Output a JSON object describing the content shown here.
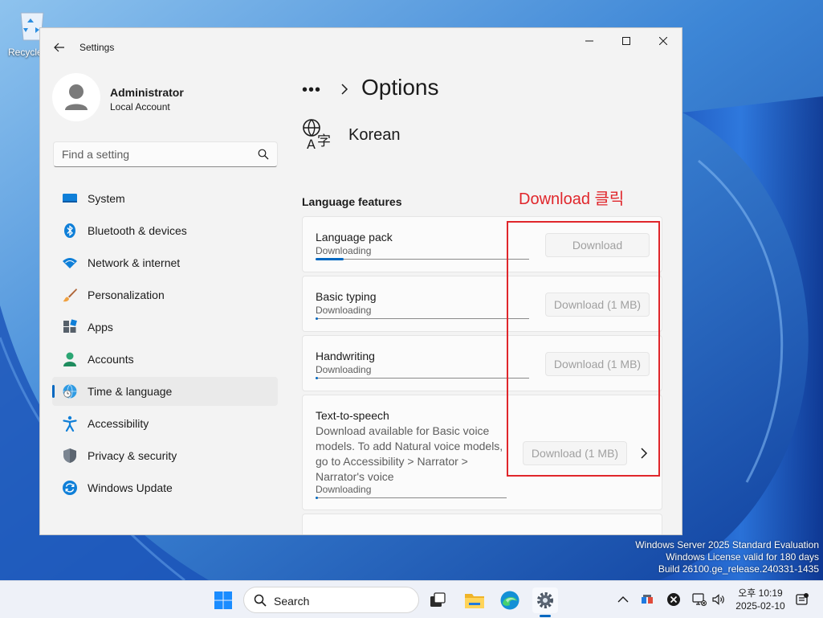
{
  "desktop": {
    "recycle_bin_label": "Recycle",
    "watermark": {
      "line1": "Windows Server 2025 Standard Evaluation",
      "line2": "Windows License valid for 180 days",
      "line3": "Build 26100.ge_release.240331-1435"
    }
  },
  "window": {
    "title": "Settings",
    "profile": {
      "name": "Administrator",
      "account_type": "Local Account"
    },
    "search": {
      "placeholder": "Find a setting"
    },
    "nav": [
      {
        "label": "System",
        "icon": "monitor-icon"
      },
      {
        "label": "Bluetooth & devices",
        "icon": "bluetooth-icon"
      },
      {
        "label": "Network & internet",
        "icon": "wifi-icon"
      },
      {
        "label": "Personalization",
        "icon": "brush-icon"
      },
      {
        "label": "Apps",
        "icon": "apps-icon"
      },
      {
        "label": "Accounts",
        "icon": "person-icon"
      },
      {
        "label": "Time & language",
        "icon": "globe-clock-icon",
        "active": true
      },
      {
        "label": "Accessibility",
        "icon": "accessibility-icon"
      },
      {
        "label": "Privacy & security",
        "icon": "shield-icon"
      },
      {
        "label": "Windows Update",
        "icon": "update-icon"
      }
    ],
    "breadcrumb": {
      "more": "•••",
      "page_title": "Options"
    },
    "language": {
      "name": "Korean",
      "icon": "language-icon"
    },
    "section_label": "Language features",
    "features": [
      {
        "title": "Language pack",
        "status": "Downloading",
        "button": "Download",
        "progress": 0.13
      },
      {
        "title": "Basic typing",
        "status": "Downloading",
        "button": "Download (1 MB)",
        "progress": 0.01
      },
      {
        "title": "Handwriting",
        "status": "Downloading",
        "button": "Download (1 MB)",
        "progress": 0.01
      },
      {
        "title": "Text-to-speech",
        "description": "Download available for Basic voice models. To add Natural voice models, go to Accessibility > Narrator > Narrator's voice",
        "status": "Downloading",
        "button": "Download (1 MB)",
        "progress": 0.01
      }
    ],
    "annotation": {
      "text": "Download 클릭",
      "color": "#e0262b"
    }
  },
  "taskbar": {
    "search_label": "Search",
    "clock": {
      "time": "오후 10:19",
      "date": "2025-02-10"
    }
  },
  "colors": {
    "accent": "#0067c0",
    "annotation": "#e0262b"
  }
}
